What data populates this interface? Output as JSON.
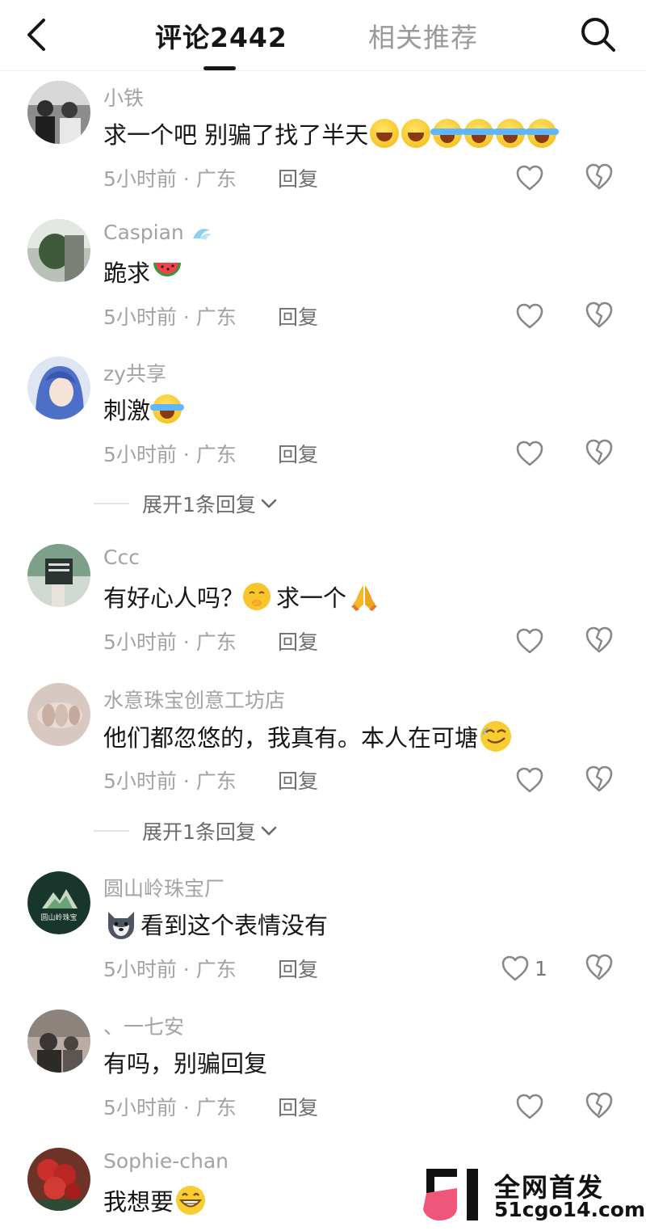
{
  "header": {
    "tab_comments": "评论2442",
    "tab_related": "相关推荐"
  },
  "comments": [
    {
      "user": "小铁",
      "text": "求一个吧 别骗了找了半天",
      "time": "5小时前 · 广东",
      "reply": "回复",
      "likes": "",
      "emojis": [
        "cry",
        "cry",
        "laugh",
        "laugh",
        "laugh",
        "laugh"
      ]
    },
    {
      "user": "Caspian",
      "text": "跪求",
      "time": "5小时前 · 广东",
      "reply": "回复",
      "likes": "",
      "emojis": [
        "watermelon"
      ]
    },
    {
      "user": "zy共享",
      "text": "刺激",
      "time": "5小时前 · 广东",
      "reply": "回复",
      "likes": "",
      "emojis": [
        "laugh"
      ]
    },
    {
      "user": "Ccc",
      "text": "有好心人吗？",
      "text2": "求一个",
      "time": "5小时前 · 广东",
      "reply": "回复",
      "likes": "",
      "emojis": [
        "shy",
        "pray"
      ]
    },
    {
      "user": "水意珠宝创意工坊店",
      "text": "他们都忽悠的，我真有。本人在可塘",
      "time": "5小时前 · 广东",
      "reply": "回复",
      "likes": "",
      "emojis": [
        "smirk"
      ]
    },
    {
      "user": "圆山岭珠宝厂",
      "text": "看到这个表情没有",
      "time": "5小时前 · 广东",
      "reply": "回复",
      "likes": "1",
      "emojis": [
        "husky"
      ]
    },
    {
      "user": "、一七安",
      "text": "有吗，别骗回复",
      "time": "5小时前 · 广东",
      "reply": "回复",
      "likes": "",
      "emojis": []
    },
    {
      "user": "Sophie-chan",
      "text": "我想要",
      "time": "",
      "reply": "",
      "likes": "",
      "emojis": [
        "grin"
      ]
    }
  ],
  "expand_replies": [
    {
      "label": "展开1条回复"
    },
    {
      "label": "展开1条回复"
    }
  ],
  "avatar_logo_text": "圆山岭珠宝",
  "watermark": {
    "logo": "51",
    "title": "全网首发",
    "url": "51cgo14.com"
  },
  "colors": {
    "muted_text": "#a3a3a3",
    "main_text": "#161616",
    "divider": "#efefef",
    "watermark_pink": "#f0557a"
  }
}
